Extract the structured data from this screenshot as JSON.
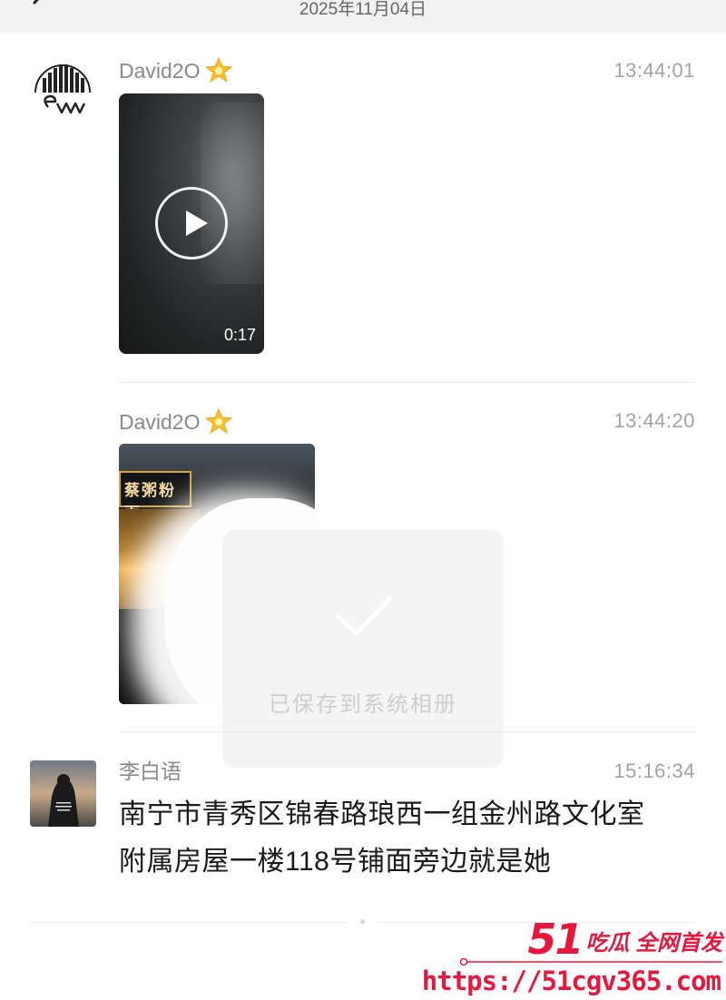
{
  "header": {
    "date": "2025年11月04日"
  },
  "messages": [
    {
      "sender": "David2O",
      "time": "13:44:01",
      "video": {
        "duration": "0:17"
      }
    },
    {
      "sender": "David2O",
      "time": "13:44:20",
      "photo": {
        "sign_text": "蔡粥粉面"
      }
    },
    {
      "sender": "李白语",
      "time": "15:16:34",
      "text_line1": "南宁市青秀区锦春路琅西一组金州路文化室",
      "text_line2": "附属房屋一楼118号铺面旁边就是她"
    }
  ],
  "toast": {
    "text": "已保存到系统相册"
  },
  "watermark": {
    "brand_number": "51",
    "brand_tag": "吃瓜 全网首发",
    "url": "https://51cgv365.com"
  },
  "colors": {
    "watermark_red": "#e8173e",
    "top_bar_bg": "#f1f1f1",
    "toast_bg": "#ebebeb"
  }
}
